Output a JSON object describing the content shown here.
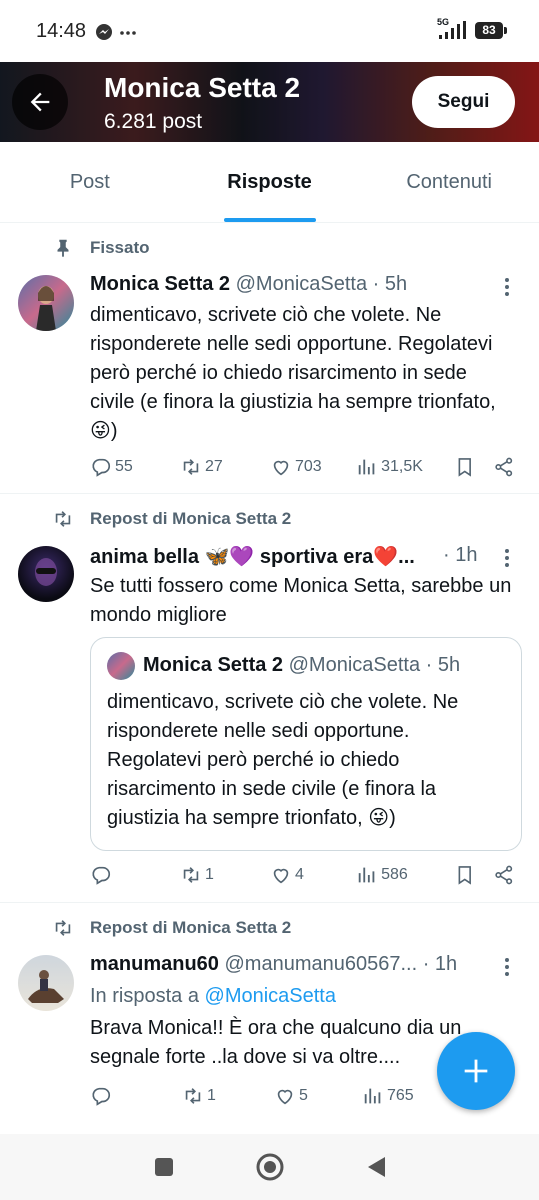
{
  "status": {
    "time": "14:48",
    "network": "5G",
    "battery": "83"
  },
  "header": {
    "title": "Monica Setta 2",
    "subtitle": "6.281 post",
    "follow_label": "Segui"
  },
  "tabs": [
    {
      "label": "Post"
    },
    {
      "label": "Risposte",
      "active": true
    },
    {
      "label": "Contenuti"
    }
  ],
  "posts": [
    {
      "context": "Fissato",
      "name": "Monica Setta 2",
      "handle": "@MonicaSetta · 5h",
      "text": "dimenticavo, scrivete ciò che volete. Ne risponderete nelle sedi opportune. Regolatevi però perché io chiedo risarcimento in sede civile (e finora la giustizia ha sempre trionfato, 😜)",
      "replies": "55",
      "reposts": "27",
      "likes": "703",
      "views": "31,5K"
    },
    {
      "context": "Repost di Monica Setta 2",
      "name": "anima bella 🦋💜 sportiva era❤️...",
      "handle": "· 1h",
      "text": "Se tutti fossero come Monica Setta, sarebbe un mondo migliore",
      "quote": {
        "name": "Monica Setta 2",
        "handle": "@MonicaSetta · 5h",
        "text": "dimenticavo, scrivete ciò che volete. Ne risponderete nelle sedi opportune. Regolatevi però perché io chiedo risarcimento in sede civile (e finora la giustizia ha sempre trionfato, 😜)"
      },
      "replies": "",
      "reposts": "1",
      "likes": "4",
      "views": "586"
    },
    {
      "context": "Repost di Monica Setta 2",
      "name": "manumanu60",
      "handle": "@manumanu60567... · 1h",
      "reply_prefix": "In risposta a",
      "reply_to": "@MonicaSetta",
      "text": "Brava Monica!! È ora che qualcuno dia un segnale forte ..la dove si va oltre....",
      "replies": "",
      "reposts": "1",
      "likes": "5",
      "views": "765"
    }
  ],
  "colors": {
    "accent": "#1d9bf0",
    "muted": "#536471",
    "text": "#0f1419"
  }
}
